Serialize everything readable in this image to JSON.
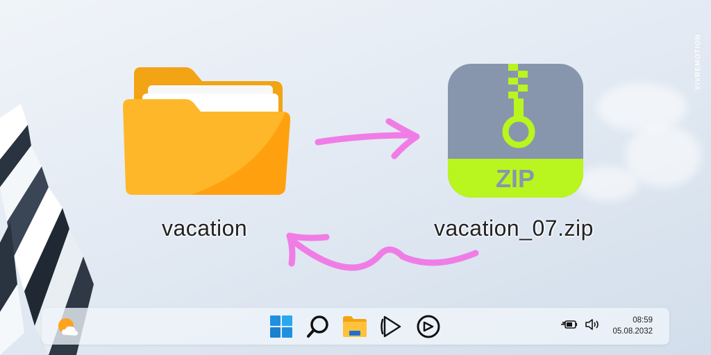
{
  "watermark": "VIVREMOTION",
  "source_item": {
    "name": "vacation",
    "icon": "folder-icon"
  },
  "target_item": {
    "name": "vacation_07.zip",
    "icon": "zip-archive-icon",
    "badge": "ZIP"
  },
  "colors": {
    "folder": "#ffb319",
    "zip_body": "#8796ad",
    "zip_accent": "#b9f51e",
    "arrow": "#f07de6"
  },
  "taskbar": {
    "weather_icon": "weather-sun-cloud-icon",
    "pinned": [
      {
        "name": "windows-start",
        "icon": "windows-logo-icon"
      },
      {
        "name": "search",
        "icon": "search-icon"
      },
      {
        "name": "file-explorer",
        "icon": "folder-icon"
      },
      {
        "name": "media-player",
        "icon": "play-icon"
      },
      {
        "name": "streaming-app",
        "icon": "elgato-icon"
      }
    ],
    "tray": {
      "power_icon": "battery-plug-icon",
      "volume_icon": "speaker-icon",
      "time": "08:59",
      "date": "05.08.2032"
    }
  }
}
